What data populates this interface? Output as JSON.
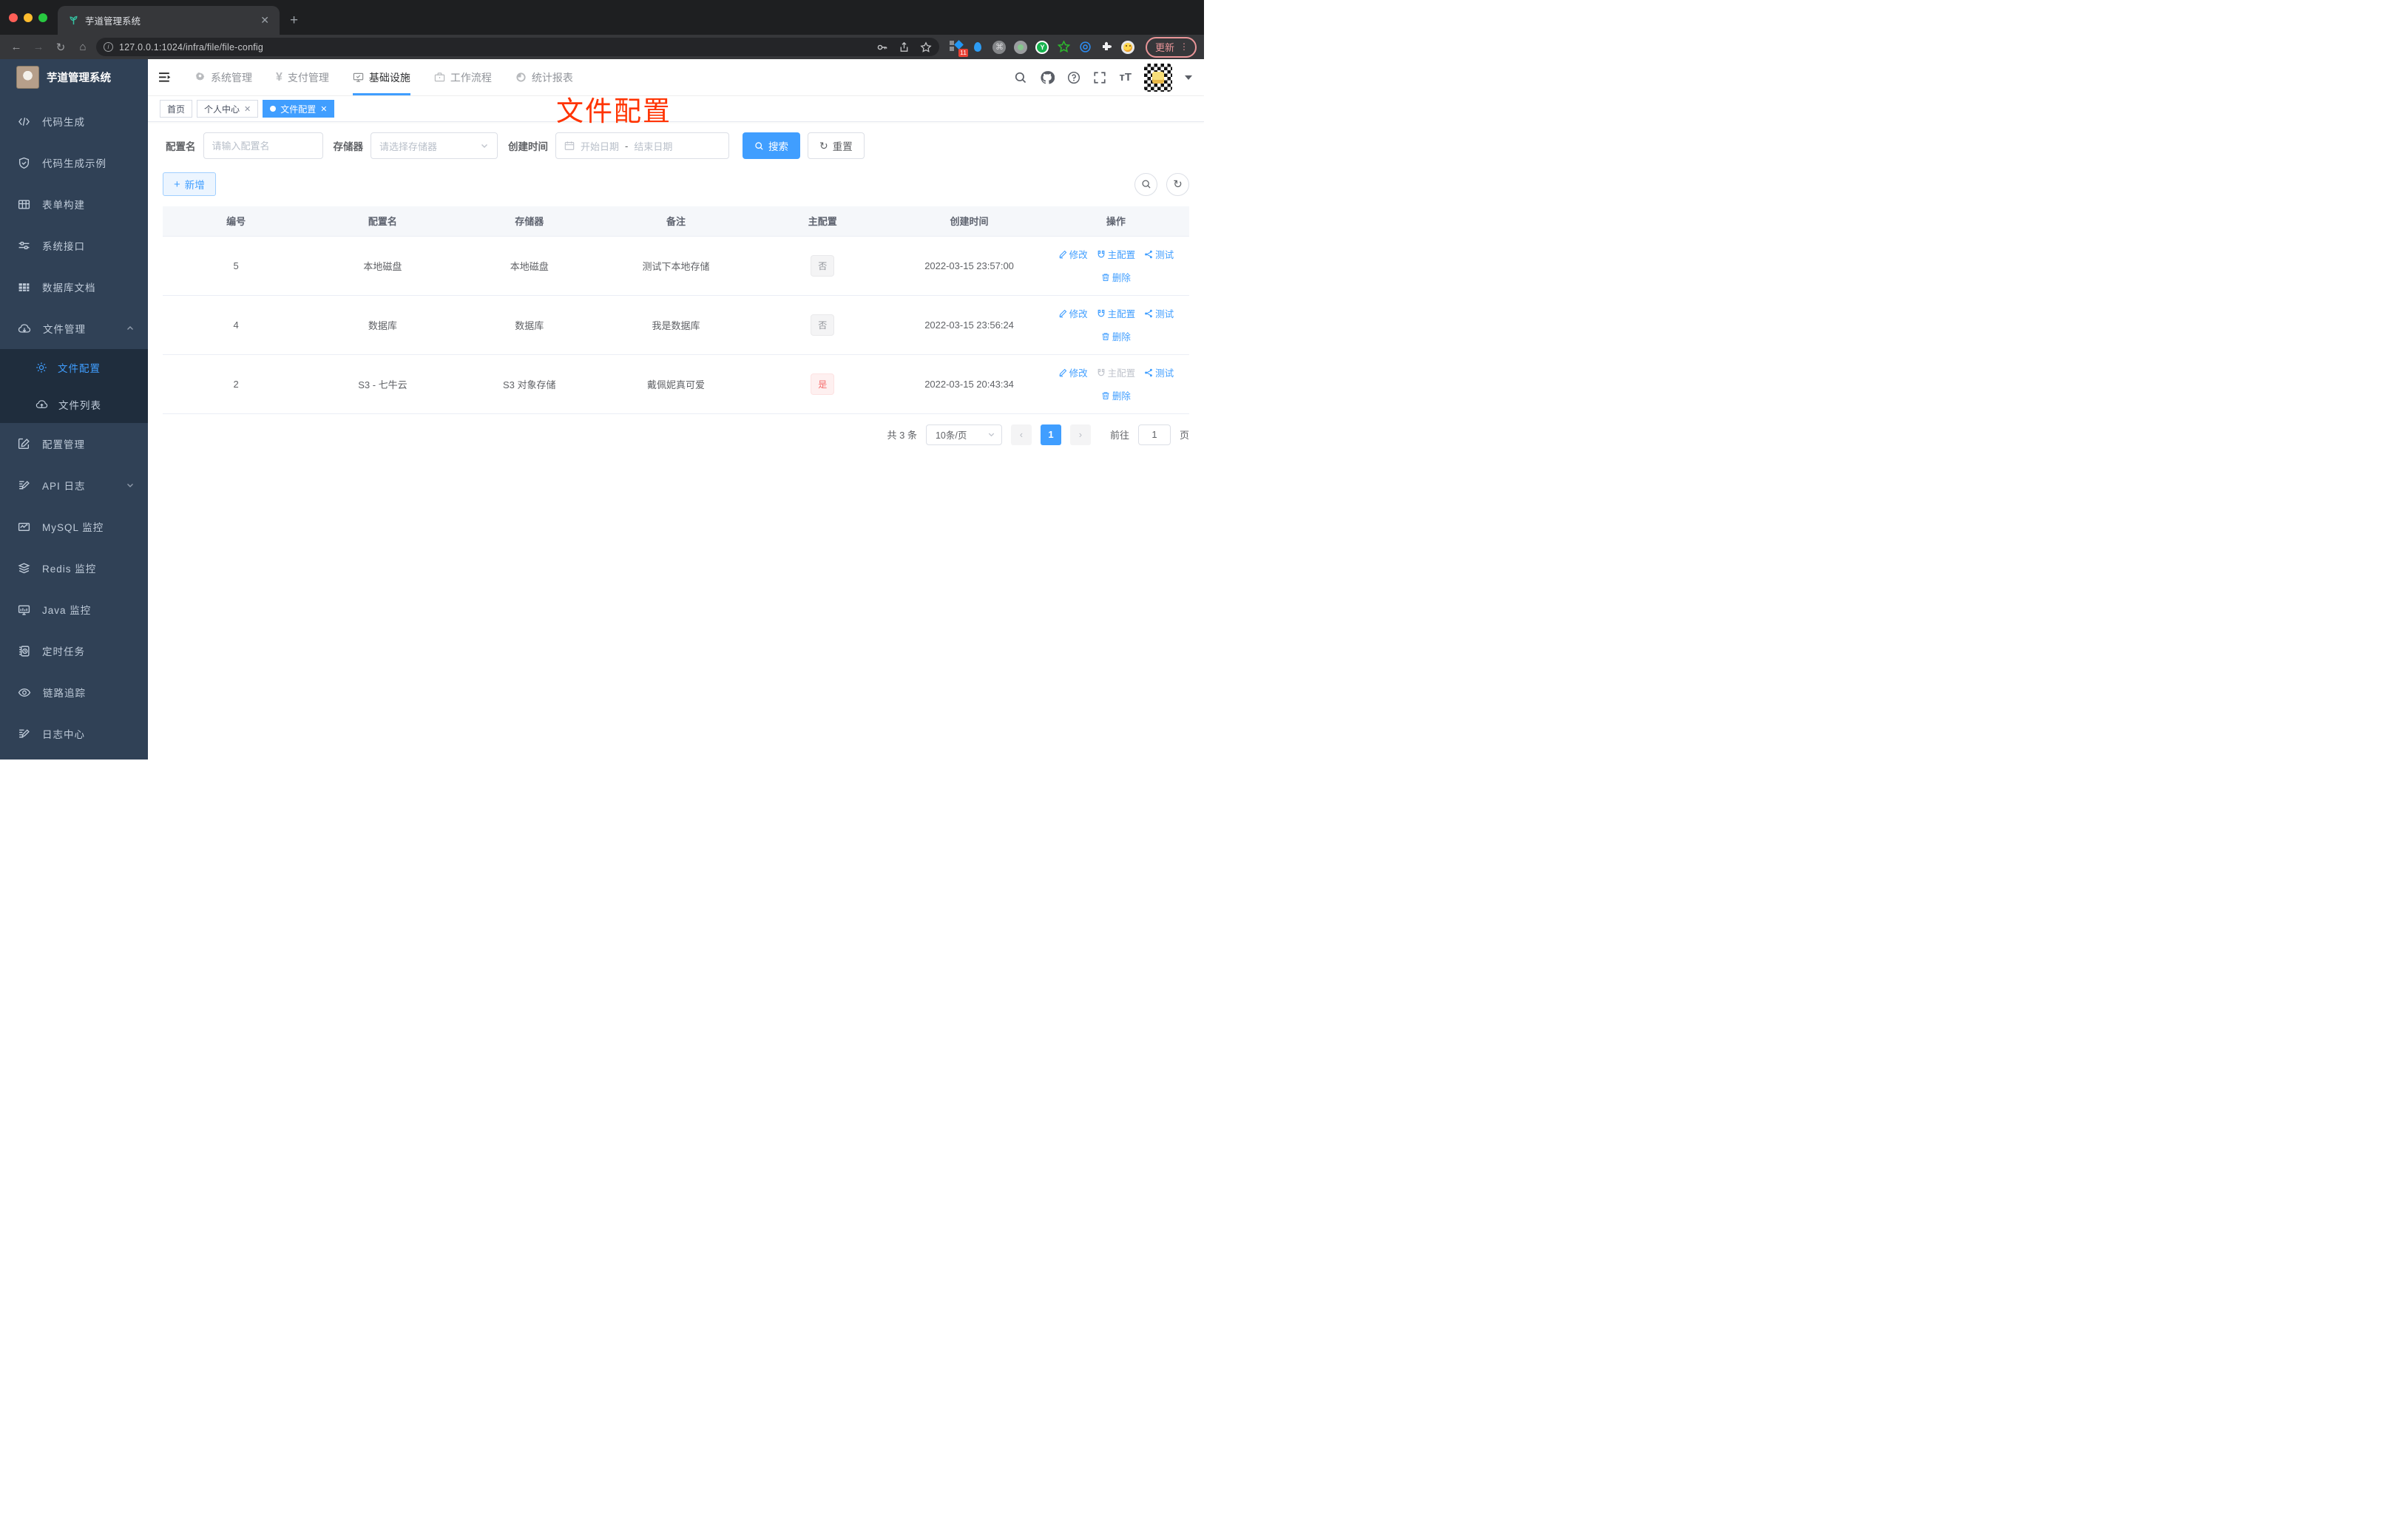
{
  "browser": {
    "tab_title": "芋道管理系统",
    "url": "127.0.0.1:1024/infra/file/file-config",
    "ext_badge": "11",
    "update_label": "更新"
  },
  "sidebar": {
    "logo_title": "芋道管理系统",
    "items": [
      {
        "label": "代码生成"
      },
      {
        "label": "代码生成示例"
      },
      {
        "label": "表单构建"
      },
      {
        "label": "系统接口"
      },
      {
        "label": "数据库文档"
      },
      {
        "label": "文件管理"
      }
    ],
    "file_submenu": [
      {
        "label": "文件配置"
      },
      {
        "label": "文件列表"
      }
    ],
    "items2": [
      {
        "label": "配置管理"
      },
      {
        "label": "API 日志"
      },
      {
        "label": "MySQL 监控"
      },
      {
        "label": "Redis 监控"
      },
      {
        "label": "Java 监控"
      },
      {
        "label": "定时任务"
      },
      {
        "label": "链路追踪"
      },
      {
        "label": "日志中心"
      }
    ]
  },
  "topnav": {
    "items": [
      {
        "label": "系统管理"
      },
      {
        "label": "支付管理"
      },
      {
        "label": "基础设施"
      },
      {
        "label": "工作流程"
      },
      {
        "label": "统计报表"
      }
    ]
  },
  "tags": {
    "home": "首页",
    "profile": "个人中心",
    "file": "文件配置"
  },
  "annotation": "文件配置",
  "filter": {
    "name_label": "配置名",
    "name_placeholder": "请输入配置名",
    "storage_label": "存储器",
    "storage_placeholder": "请选择存储器",
    "time_label": "创建时间",
    "start_placeholder": "开始日期",
    "separator": "-",
    "end_placeholder": "结束日期",
    "search_label": "搜索",
    "reset_label": "重置"
  },
  "toolbar": {
    "add_label": "新增"
  },
  "table": {
    "columns": [
      "编号",
      "配置名",
      "存储器",
      "备注",
      "主配置",
      "创建时间",
      "操作"
    ],
    "actions": {
      "edit": "修改",
      "master": "主配置",
      "test": "测试",
      "del": "删除"
    },
    "rows": [
      {
        "id": "5",
        "name": "本地磁盘",
        "storage": "本地磁盘",
        "remark": "测试下本地存储",
        "master": "否",
        "created": "2022-03-15 23:57:00"
      },
      {
        "id": "4",
        "name": "数据库",
        "storage": "数据库",
        "remark": "我是数据库",
        "master": "否",
        "created": "2022-03-15 23:56:24"
      },
      {
        "id": "2",
        "name": "S3 - 七牛云",
        "storage": "S3 对象存储",
        "remark": "戴佩妮真可爱",
        "master": "是",
        "created": "2022-03-15 20:43:34"
      }
    ]
  },
  "pagination": {
    "total": "共 3 条",
    "size": "10条/页",
    "page": "1",
    "goto": "前往",
    "goto_value": "1",
    "unit": "页"
  },
  "colors": {
    "accent": "#409eff",
    "danger": "#f56c6c",
    "annotation": "#ff3300"
  }
}
